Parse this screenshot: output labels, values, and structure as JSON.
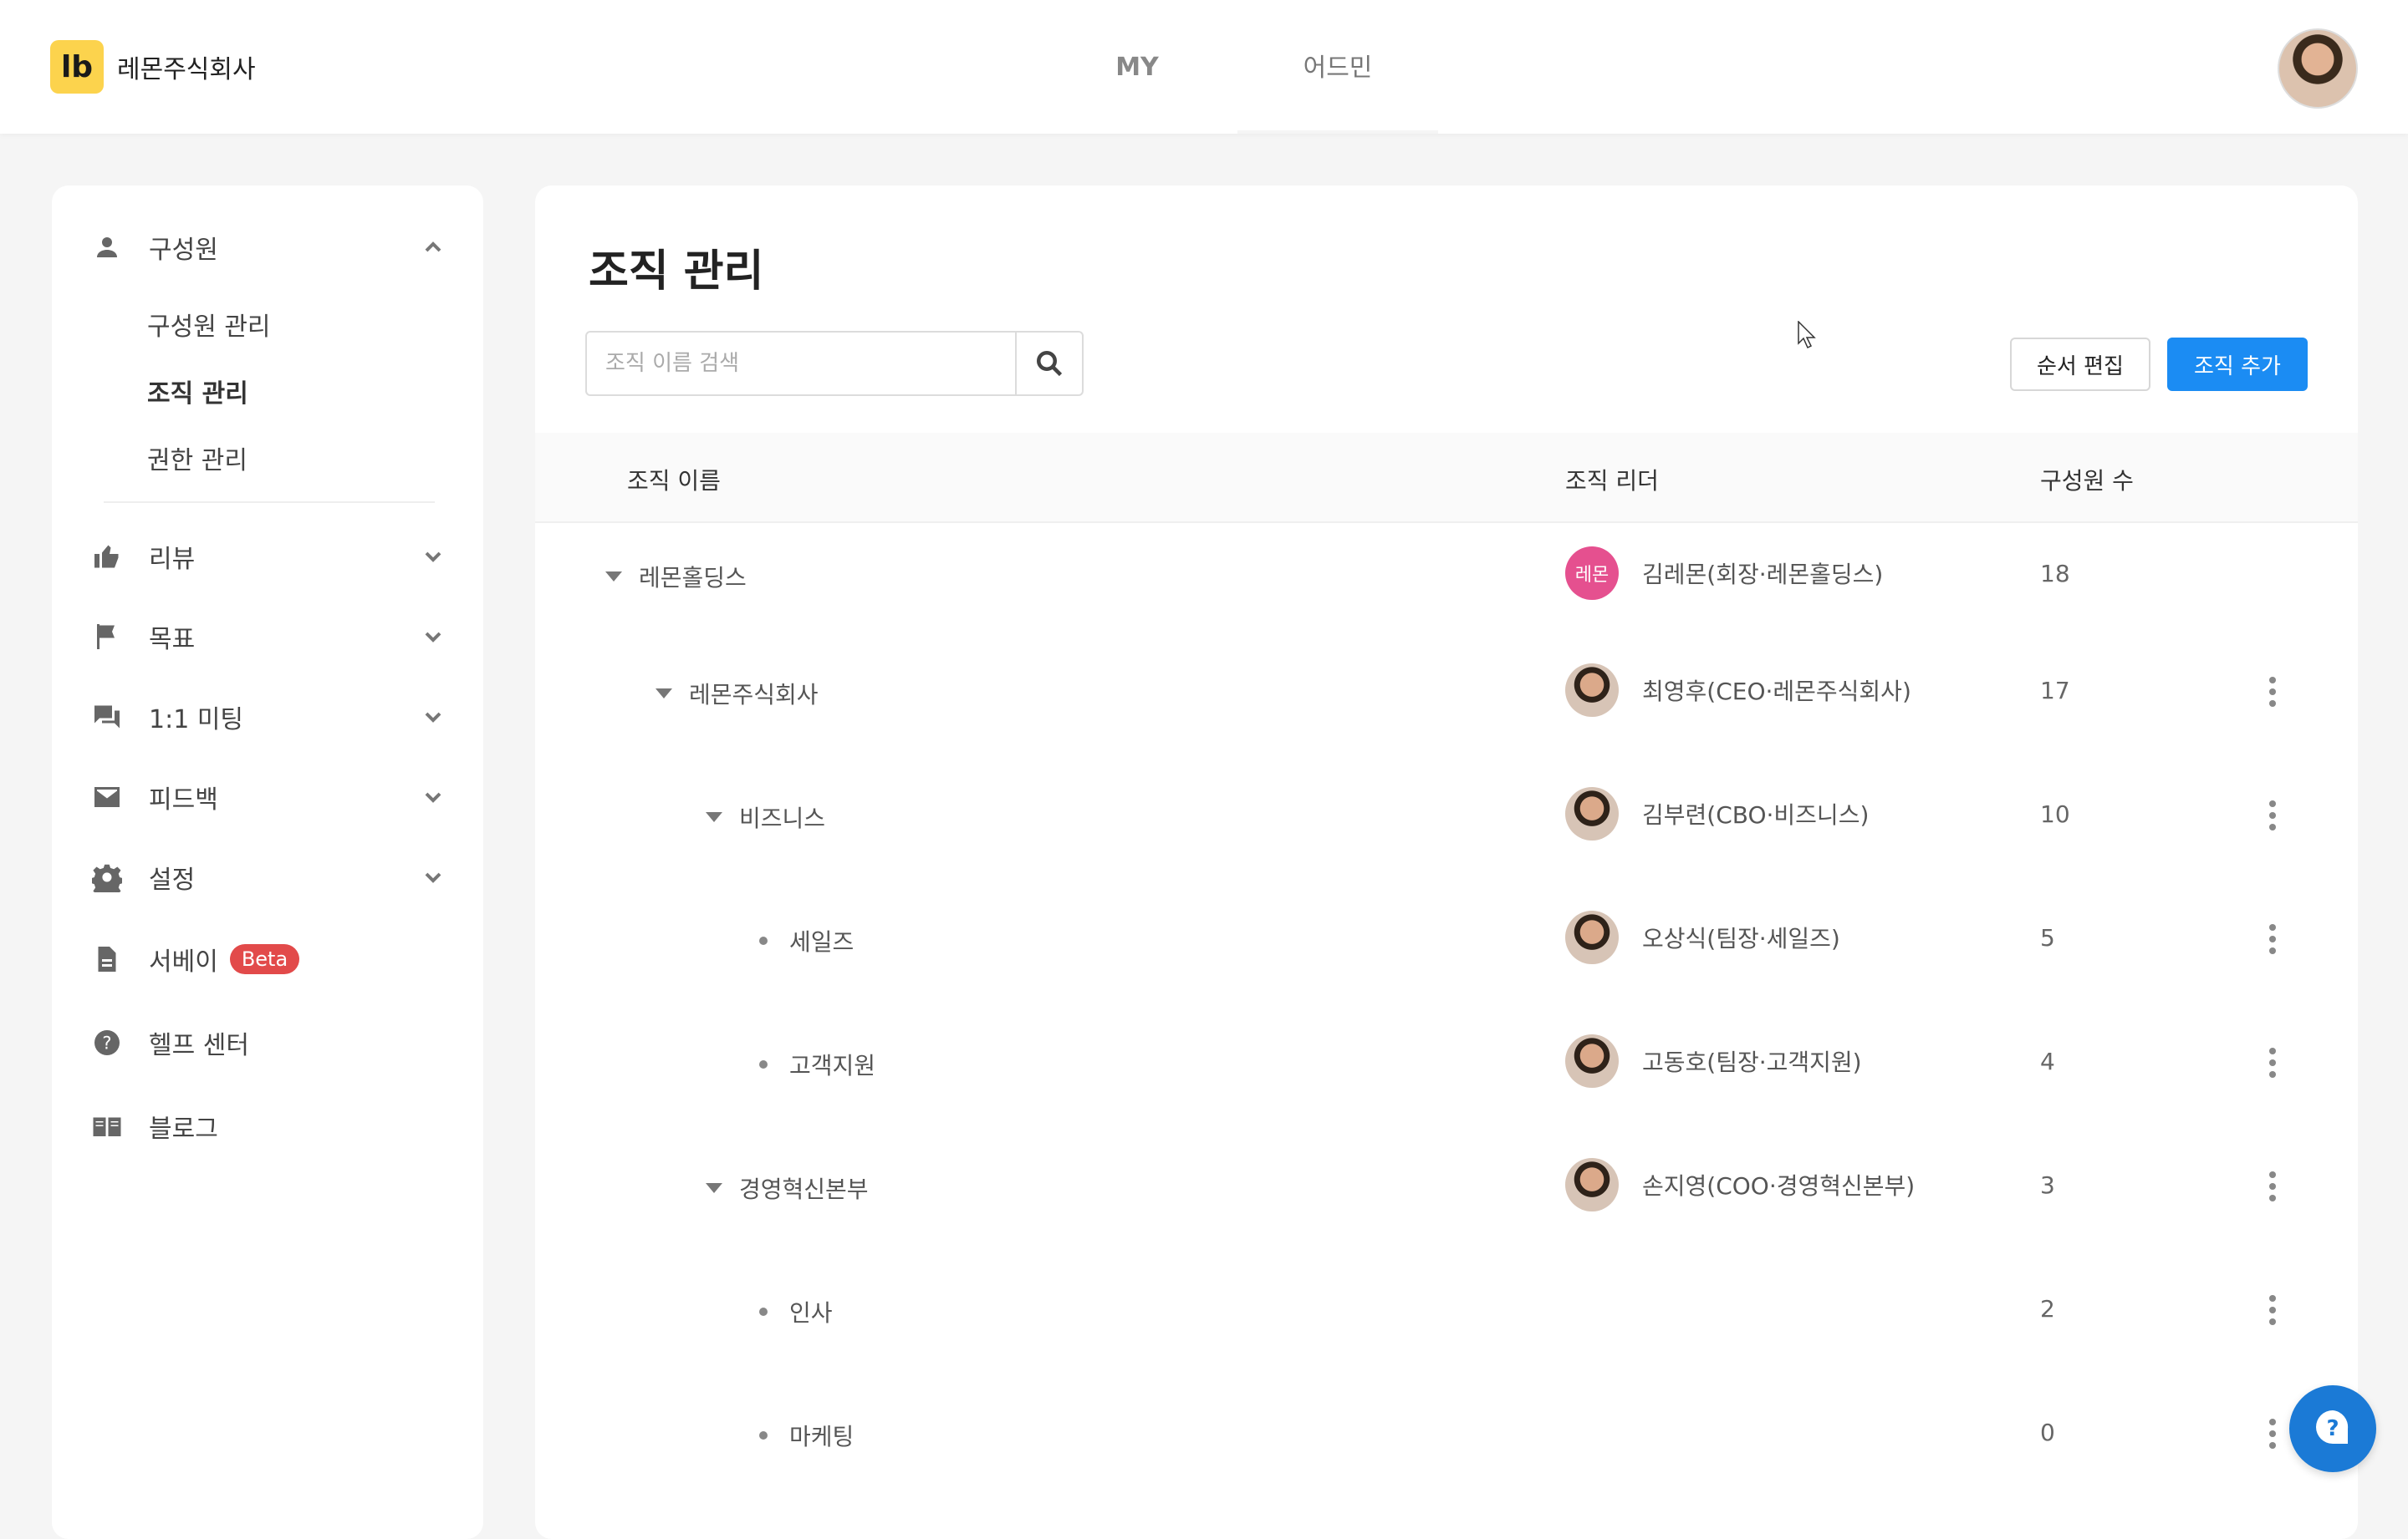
{
  "header": {
    "logo_mark": "lb",
    "company": "레몬주식회사",
    "tabs": [
      {
        "label": "MY"
      },
      {
        "label": "어드민"
      }
    ]
  },
  "sidebar": {
    "members": {
      "label": "구성원",
      "items": [
        "구성원 관리",
        "조직 관리",
        "권한 관리"
      ]
    },
    "groups": [
      {
        "label": "리뷰",
        "icon": "thumbs-up-icon"
      },
      {
        "label": "목표",
        "icon": "flag-icon"
      },
      {
        "label": "1:1 미팅",
        "icon": "chat-icon"
      },
      {
        "label": "피드백",
        "icon": "mail-icon"
      },
      {
        "label": "설정",
        "icon": "gear-icon"
      },
      {
        "label": "서베이",
        "icon": "document-icon",
        "badge": "Beta"
      },
      {
        "label": "헬프 센터",
        "icon": "help-icon"
      },
      {
        "label": "블로그",
        "icon": "book-icon"
      }
    ]
  },
  "main": {
    "title": "조직 관리",
    "search": {
      "placeholder": "조직 이름 검색",
      "value": ""
    },
    "order_button": "순서 편집",
    "add_button": "조직 추가",
    "columns": {
      "name": "조직 이름",
      "leader": "조직 리더",
      "count": "구성원 수"
    },
    "rows": [
      {
        "name": "레몬홀딩스",
        "leader": "김레몬(회장·레몬홀딩스)",
        "leader_avatar_text": "레몬",
        "count": "18"
      },
      {
        "name": "레몬주식회사",
        "leader": "최영후(CEO·레몬주식회사)",
        "count": "17"
      },
      {
        "name": "비즈니스",
        "leader": "김부련(CBO·비즈니스)",
        "count": "10"
      },
      {
        "name": "세일즈",
        "leader": "오상식(팀장·세일즈)",
        "count": "5"
      },
      {
        "name": "고객지원",
        "leader": "고동호(팀장·고객지원)",
        "count": "4"
      },
      {
        "name": "경영혁신본부",
        "leader": "손지영(COO·경영혁신본부)",
        "count": "3"
      },
      {
        "name": "인사",
        "leader": "",
        "count": "2"
      },
      {
        "name": "마케팅",
        "leader": "",
        "count": "0"
      }
    ]
  },
  "colors": {
    "primary": "#1b8cf3",
    "logo": "#fcd34d",
    "beta": "#e24a4a",
    "lemon_avatar": "#e5508f"
  }
}
